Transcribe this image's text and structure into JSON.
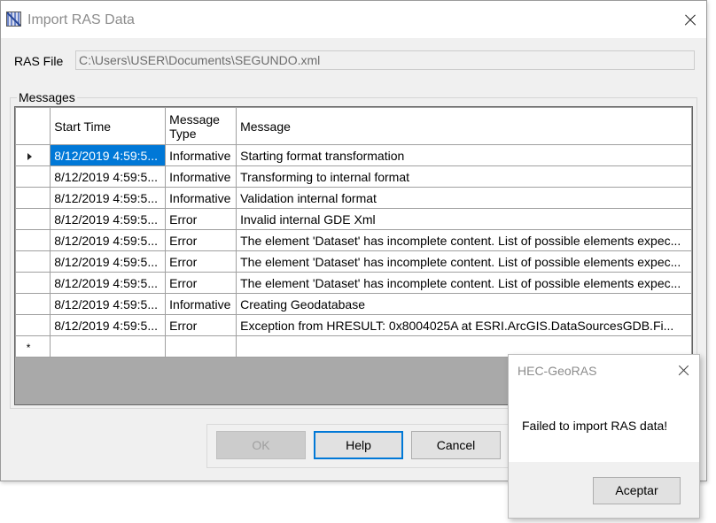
{
  "main_window": {
    "title": "Import RAS Data",
    "ras_file_label": "RAS File",
    "ras_file_value": "C:\\Users\\USER\\Documents\\SEGUNDO.xml",
    "messages_group_label": "Messages"
  },
  "grid": {
    "columns": [
      "Start Time",
      "Message\nType",
      "Message"
    ],
    "rows": [
      {
        "start": "8/12/2019 4:59:5...",
        "type": "Informative",
        "message": "Starting format transformation"
      },
      {
        "start": "8/12/2019 4:59:5...",
        "type": "Informative",
        "message": "Transforming to internal format"
      },
      {
        "start": "8/12/2019 4:59:5...",
        "type": "Informative",
        "message": "Validation internal format"
      },
      {
        "start": "8/12/2019 4:59:5...",
        "type": "Error",
        "message": "Invalid internal GDE Xml"
      },
      {
        "start": "8/12/2019 4:59:5...",
        "type": "Error",
        "message": "The element 'Dataset' has incomplete content. List of possible elements expec..."
      },
      {
        "start": "8/12/2019 4:59:5...",
        "type": "Error",
        "message": "The element 'Dataset' has incomplete content. List of possible elements expec..."
      },
      {
        "start": "8/12/2019 4:59:5...",
        "type": "Error",
        "message": "The element 'Dataset' has incomplete content. List of possible elements expec..."
      },
      {
        "start": "8/12/2019 4:59:5...",
        "type": "Informative",
        "message": "Creating Geodatabase"
      },
      {
        "start": "8/12/2019 4:59:5...",
        "type": "Error",
        "message": "Exception from HRESULT: 0x8004025A    at ESRI.ArcGIS.DataSourcesGDB.Fi..."
      }
    ],
    "new_row_marker": "*"
  },
  "buttons": {
    "ok": "OK",
    "help": "Help",
    "cancel": "Cancel"
  },
  "message_box": {
    "title": "HEC-GeoRAS",
    "text": "Failed to import RAS data!",
    "accept": "Aceptar"
  },
  "colors": {
    "selection": "#0078d7",
    "dialog_bg": "#f0f0f0",
    "grid_empty_bg": "#a9a9a9"
  }
}
